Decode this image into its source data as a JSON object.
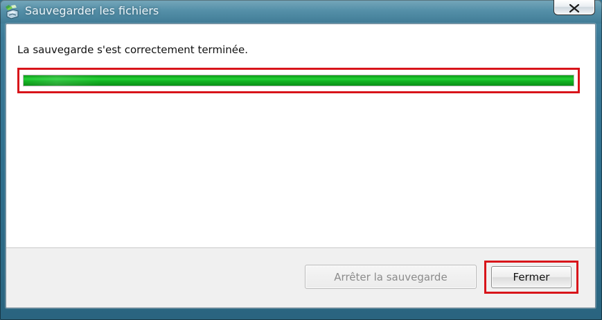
{
  "window": {
    "title": "Sauvegarder les fichiers",
    "close_glyph": "X",
    "icon": "backup-files-icon"
  },
  "main": {
    "status_message": "La sauvegarde s'est correctement terminée.",
    "progress": {
      "percent": 100
    }
  },
  "footer": {
    "stop_backup_label": "Arrêter la sauvegarde",
    "close_label": "Fermer"
  },
  "colors": {
    "highlight_red": "#d8141a",
    "progress_green": "#1fc52f",
    "titlebar_blue": "#2f6f8d"
  }
}
